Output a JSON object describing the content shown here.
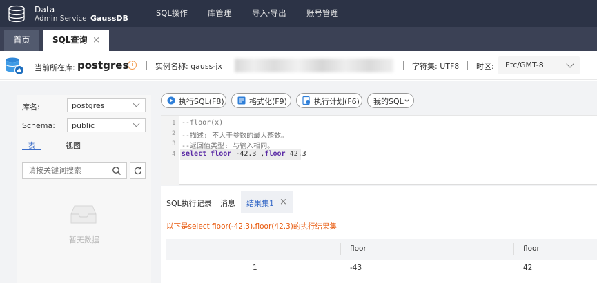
{
  "header": {
    "app_name_line1": "Data",
    "app_name_line2": "Admin Service",
    "product": "GaussDB",
    "nav": [
      "SQL操作",
      "库管理",
      "导入·导出",
      "账号管理"
    ]
  },
  "tabs": [
    {
      "label": "首页"
    },
    {
      "label": "SQL查询",
      "close": "×"
    }
  ],
  "infobar": {
    "current_db_label": "当前所在库:",
    "current_db": "postgres",
    "instance_label": "实例名称: gauss-jx",
    "charset_label": "字符集: UTF8",
    "timezone_label": "时区:",
    "timezone_value": "Etc/GMT-8"
  },
  "left_panel": {
    "db_label": "库名:",
    "db_value": "postgres",
    "schema_label": "Schema:",
    "schema_value": "public",
    "subtabs": [
      "表",
      "视图"
    ],
    "search_placeholder": "请按关键词搜索",
    "empty_text": "暂无数据"
  },
  "toolbar": {
    "execute": "执行SQL(F8)",
    "format": "格式化(F9)",
    "plan": "执行计划(F6)",
    "my_sql": "我的SQL"
  },
  "editor": {
    "line_numbers": [
      "1",
      "2",
      "3",
      "4"
    ],
    "lines": [
      "--floor(x)",
      "--描述: 不大于参数的最大整数。",
      "--返回值类型: 与输入相同。"
    ],
    "line4": {
      "kw1": "select",
      "kw2": "floor",
      "arg1": "-42.3",
      "comma": " ,",
      "kw3": "floor",
      "arg2": "42.3"
    }
  },
  "results": {
    "tabs": [
      "SQL执行记录",
      "消息",
      "结果集1"
    ],
    "close": "×",
    "message": "以下是select floor(-42.3),floor(42.3)的执行结果集",
    "columns": [
      "",
      "floor",
      "floor"
    ],
    "rows": [
      [
        "1",
        "-43",
        "42"
      ]
    ]
  },
  "colors": {
    "topnav": "#2c3346",
    "accent": "#3a6cc8",
    "message": "#e8590c",
    "info": "#f2994a"
  }
}
